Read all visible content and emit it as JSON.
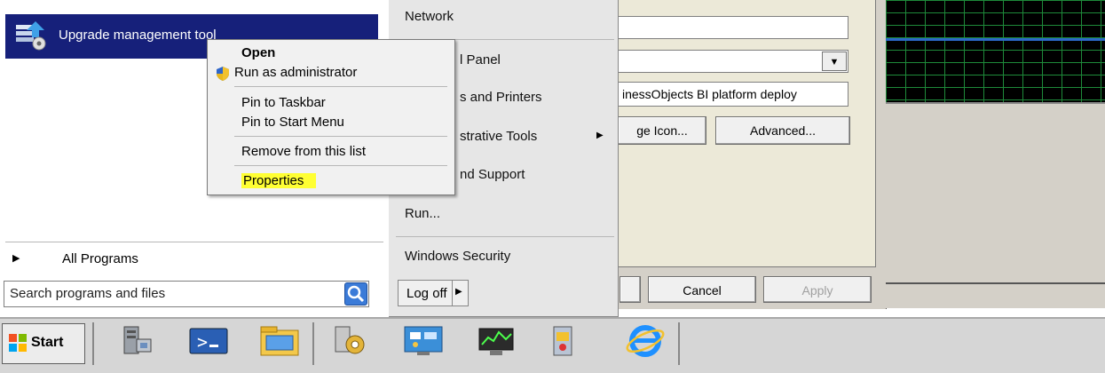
{
  "start_menu": {
    "pinned_item_label": "Upgrade management tool",
    "all_programs_label": "All Programs",
    "search_placeholder": "Search programs and files",
    "right_items": [
      "Network",
      "Control Panel",
      "Devices and Printers",
      "Administrative Tools",
      "Help and Support",
      "Run...",
      "Windows Security"
    ],
    "logoff_label": "Log off"
  },
  "context_menu": {
    "items": [
      "Open",
      "Run as administrator",
      "Pin to Taskbar",
      "Pin to Start Menu",
      "Remove from this list",
      "Properties"
    ]
  },
  "dialog": {
    "target_text": "inessObjects BI platform deploy",
    "change_icon_label": "ge Icon...",
    "advanced_label": "Advanced...",
    "cancel_label": "Cancel",
    "apply_label": "Apply"
  },
  "right_menu_visible": {
    "control_panel": "l Panel",
    "devices": "s and Printers",
    "admin_tools": "strative Tools",
    "help": "nd Support"
  },
  "taskbar": {
    "start_label": "Start",
    "apps": [
      "server-manager-icon",
      "powershell-icon",
      "explorer-icon",
      "settings-icon",
      "control-panel-icon",
      "performance-monitor-icon",
      "security-icon",
      "internet-explorer-icon"
    ]
  },
  "colors": {
    "selected_bg": "#16207a",
    "highlight": "#ffff33",
    "grid_line": "#2b68c7"
  }
}
